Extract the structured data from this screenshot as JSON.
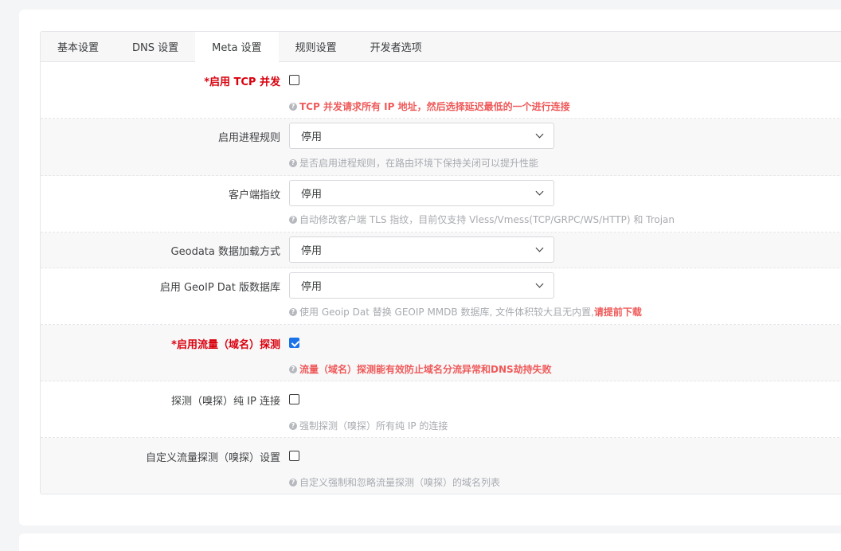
{
  "tabs": [
    {
      "label": "基本设置",
      "active": false
    },
    {
      "label": "DNS 设置",
      "active": false
    },
    {
      "label": "Meta 设置",
      "active": true
    },
    {
      "label": "规则设置",
      "active": false
    },
    {
      "label": "开发者选项",
      "active": false
    }
  ],
  "rows": {
    "tcp_concurrent": {
      "label": "启用 TCP 并发",
      "checked": false,
      "help": "TCP 并发请求所有 IP 地址，然后选择延迟最低的一个进行连接"
    },
    "process_rules": {
      "label": "启用进程规则",
      "value": "停用",
      "help": "是否启用进程规则，在路由环境下保持关闭可以提升性能"
    },
    "client_fingerprint": {
      "label": "客户端指纹",
      "value": "停用",
      "help": "自动修改客户端 TLS 指纹，目前仅支持 Vless/Vmess(TCP/GRPC/WS/HTTP) 和 Trojan"
    },
    "geodata_loader": {
      "label": "Geodata 数据加载方式",
      "value": "停用"
    },
    "geoip_dat": {
      "label": "启用 GeoIP Dat 版数据库",
      "value": "停用",
      "help": "使用 Geoip Dat 替换 GEOIP MMDB 数据库, 文件体积较大且无内置, ",
      "help_emphasis": "请提前下载"
    },
    "sniffer": {
      "label": "启用流量（域名）探测",
      "checked": true,
      "help": "流量（域名）探测能有效防止域名分流异常和DNS劫持失败"
    },
    "sniff_pure_ip": {
      "label": "探测（嗅探）纯 IP 连接",
      "checked": false,
      "help": "强制探测（嗅探）所有纯 IP 的连接"
    },
    "custom_sniffer": {
      "label": "自定义流量探测（嗅探）设置",
      "checked": false,
      "help": "自定义强制和忽略流量探测（嗅探）的域名列表"
    }
  },
  "icons": {
    "help": "question-circle-icon",
    "dropdown": "chevron-down-icon"
  },
  "colors": {
    "required_label": "#d9000d",
    "highlight_help": "#ef5a5a",
    "muted_help": "#a8abb0",
    "checkbox_checked": "#1a73e8"
  }
}
